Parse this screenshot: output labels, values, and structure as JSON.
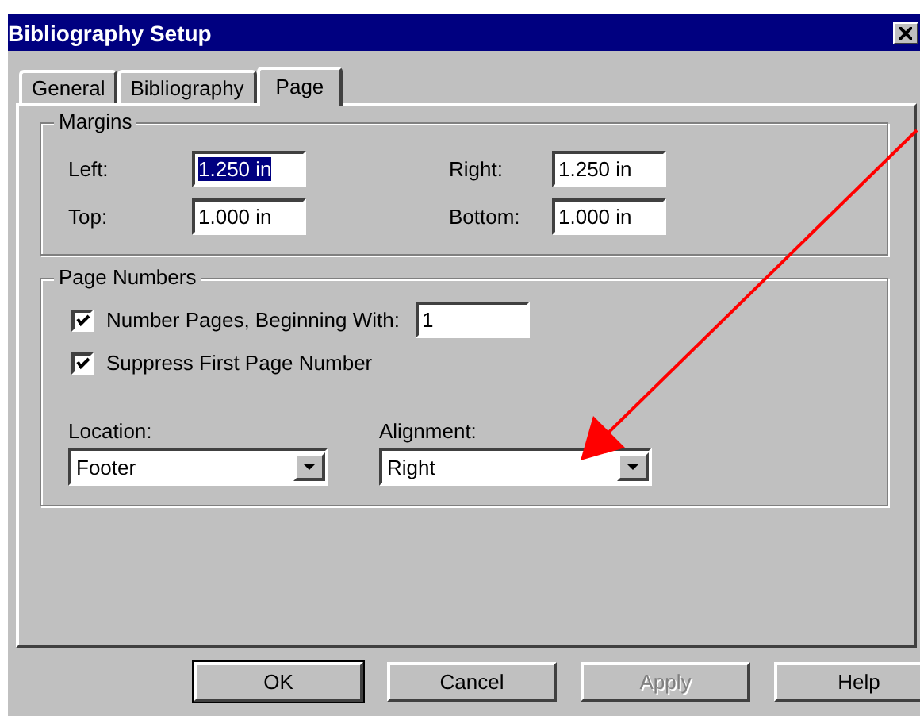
{
  "window": {
    "title": "Bibliography Setup"
  },
  "tabs": [
    {
      "label": "General",
      "selected": false
    },
    {
      "label": "Bibliography",
      "selected": false
    },
    {
      "label": "Page",
      "selected": true
    }
  ],
  "margins": {
    "title": "Margins",
    "fields": [
      {
        "label": "Left:",
        "value": "1.250 in",
        "highlighted": true
      },
      {
        "label": "Right:",
        "value": "1.250 in",
        "highlighted": false
      },
      {
        "label": "Top:",
        "value": "1.000 in",
        "highlighted": false
      },
      {
        "label": "Bottom:",
        "value": "1.000 in",
        "highlighted": false
      }
    ]
  },
  "page_numbers": {
    "title": "Page Numbers",
    "checkboxes": [
      {
        "label": "Number Pages, Beginning With:",
        "checked": true,
        "value": "1"
      },
      {
        "label": "Suppress First Page Number",
        "checked": true
      }
    ],
    "dropdowns": [
      {
        "label": "Location:",
        "value": "Footer"
      },
      {
        "label": "Alignment:",
        "value": "Right"
      }
    ]
  },
  "buttons": [
    {
      "label": "OK",
      "default": true,
      "disabled": false
    },
    {
      "label": "Cancel",
      "default": false,
      "disabled": false
    },
    {
      "label": "Apply",
      "default": false,
      "disabled": true
    },
    {
      "label": "Help",
      "default": false,
      "disabled": false
    }
  ]
}
